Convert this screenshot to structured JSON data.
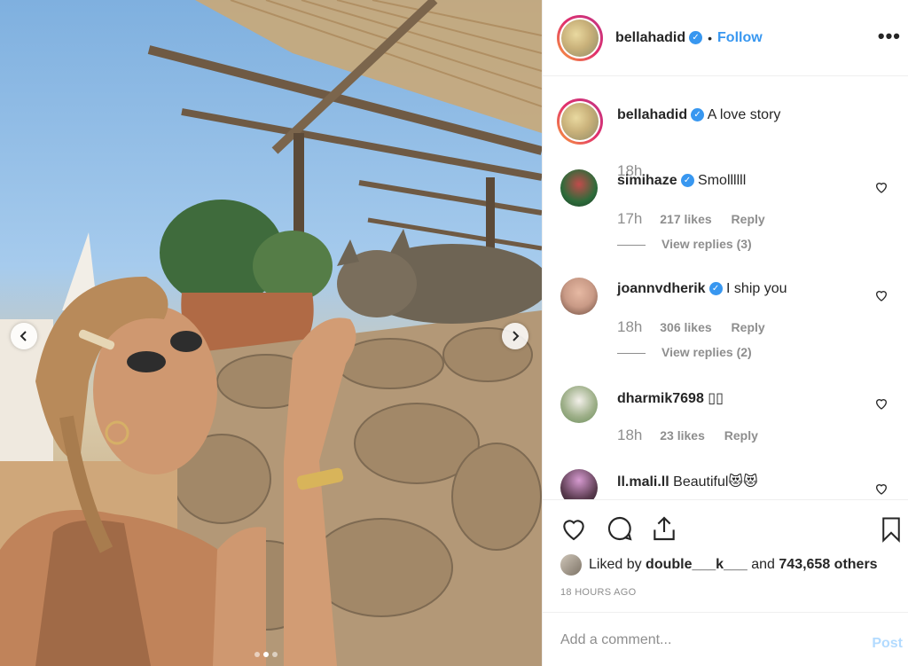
{
  "post_image": {
    "description_icon": "photo-carousel",
    "carousel": {
      "count": 3,
      "active_index": 1
    }
  },
  "header": {
    "username": "bellahadid",
    "verified": true,
    "separator": "•",
    "follow_label": "Follow",
    "more_label": "•••"
  },
  "caption": {
    "username": "bellahadid",
    "text": "A love story",
    "time": "18h"
  },
  "comments": [
    {
      "username": "simihaze",
      "verified": true,
      "text": "Smollllll",
      "time": "17h",
      "likes": "217 likes",
      "reply_label": "Reply",
      "view_replies": "View replies (3)",
      "avatar_color": "#2d6b3a"
    },
    {
      "username": "joannvdherik",
      "verified": true,
      "text": "I ship you",
      "time": "18h",
      "likes": "306 likes",
      "reply_label": "Reply",
      "view_replies": "View replies (2)",
      "avatar_color": "#c99a86"
    },
    {
      "username": "dharmik7698",
      "verified": false,
      "text": "▯▯",
      "time": "18h",
      "likes": "23 likes",
      "reply_label": "Reply",
      "view_replies": "",
      "avatar_color": "#6a8d5a"
    },
    {
      "username": "ll.mali.ll",
      "verified": false,
      "text": "Beautiful😻😻",
      "time": "",
      "likes": "",
      "reply_label": "",
      "view_replies": "",
      "avatar_color": "#5a3b4f"
    }
  ],
  "likes": {
    "prefix": "Liked by ",
    "user": "double___k___",
    "middle": " and ",
    "others": "743,658 others"
  },
  "post_time": "18 HOURS AGO",
  "add_comment": {
    "placeholder": "Add a comment...",
    "post_label": "Post"
  },
  "colors": {
    "accent": "#3897f0",
    "muted": "#8e8e8e",
    "post_disabled": "#b3dbff"
  }
}
